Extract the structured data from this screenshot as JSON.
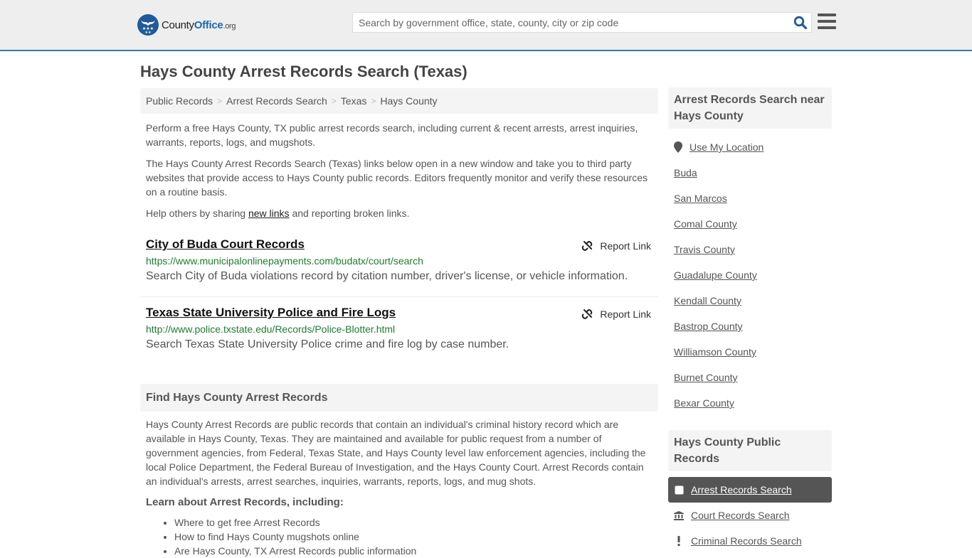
{
  "header": {
    "logo": {
      "name": "County",
      "brand": "Office",
      "tld": ".org"
    },
    "search_placeholder": "Search by government office, state, county, city or zip code",
    "search_value": "",
    "icons": {
      "search": "search-icon",
      "menu": "hamburger-menu-icon"
    },
    "accent_color": "#337ab7"
  },
  "page": {
    "title": "Hays County Arrest Records Search (Texas)"
  },
  "breadcrumb": [
    {
      "label": "Public Records"
    },
    {
      "label": "Arrest Records Search"
    },
    {
      "label": "Texas"
    },
    {
      "label": "Hays County"
    }
  ],
  "breadcrumb_separator": ">",
  "intro": {
    "p1": "Perform a free Hays County, TX public arrest records search, including current & recent arrests, arrest inquiries, warrants, reports, logs, and mugshots.",
    "p2": "The Hays County Arrest Records Search (Texas) links below open in a new window and take you to third party websites that provide access to Hays County public records. Editors frequently monitor and verify these resources on a routine basis.",
    "p3_before": "Help others by sharing ",
    "p3_link": "new links",
    "p3_after": " and reporting broken links."
  },
  "links": [
    {
      "title": "City of Buda Court Records",
      "url": "https://www.municipalonlinepayments.com/budatx/court/search",
      "description": "Search City of Buda violations record by citation number, driver's license, or vehicle information.",
      "report_label": "Report Link"
    },
    {
      "title": "Texas State University Police and Fire Logs",
      "url": "http://www.police.txstate.edu/Records/Police-Blotter.html",
      "description": "Search Texas State University Police crime and fire log by case number.",
      "report_label": "Report Link"
    }
  ],
  "find_section": {
    "heading": "Find Hays County Arrest Records",
    "body": "Hays County Arrest Records are public records that contain an individual's criminal history record which are available in Hays County, Texas. They are maintained and available for public request from a number of government agencies, from Federal, Texas State, and Hays County level law enforcement agencies, including the local Police Department, the Federal Bureau of Investigation, and the Hays County Court. Arrest Records contain an individual's arrests, arrest searches, inquiries, warrants, reports, logs, and mug shots.",
    "learn_heading": "Learn about Arrest Records, including:",
    "learn_items": [
      "Where to get free Arrest Records",
      "How to find Hays County mugshots online",
      "Are Hays County, TX Arrest Records public information"
    ]
  },
  "sidebar": {
    "near_heading": "Arrest Records Search near Hays County",
    "use_location": "Use My Location",
    "near_items": [
      "Buda",
      "San Marcos",
      "Comal County",
      "Travis County",
      "Guadalupe County",
      "Kendall County",
      "Bastrop County",
      "Williamson County",
      "Burnet County",
      "Bexar County"
    ],
    "public_records_heading": "Hays County Public Records",
    "public_records_items": [
      {
        "label": "Arrest Records Search",
        "icon": "square-icon",
        "active": true
      },
      {
        "label": "Court Records Search",
        "icon": "courthouse-icon",
        "active": false
      },
      {
        "label": "Criminal Records Search",
        "icon": "exclamation-icon",
        "active": false
      }
    ]
  }
}
